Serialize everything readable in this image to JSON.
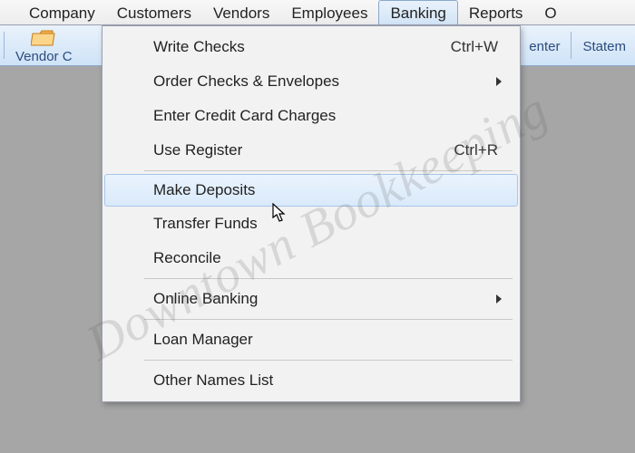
{
  "menubar": {
    "items": [
      {
        "label": "Company"
      },
      {
        "label": "Customers"
      },
      {
        "label": "Vendors"
      },
      {
        "label": "Employees"
      },
      {
        "label": "Banking",
        "active": true
      },
      {
        "label": "Reports"
      },
      {
        "label": "O"
      }
    ]
  },
  "toolbar": {
    "vendor_label": "Vendor C",
    "enter_label": "enter",
    "statem_label": "Statem"
  },
  "dropdown": {
    "items": [
      {
        "label": "Write Checks",
        "accel": "Ctrl+W"
      },
      {
        "label": "Order Checks & Envelopes",
        "submenu": true
      },
      {
        "label": "Enter Credit Card Charges"
      },
      {
        "label": "Use Register",
        "accel": "Ctrl+R"
      },
      {
        "sep": true
      },
      {
        "label": "Make Deposits",
        "hovered": true
      },
      {
        "label": "Transfer Funds"
      },
      {
        "label": "Reconcile"
      },
      {
        "sep": true
      },
      {
        "label": "Online Banking",
        "submenu": true
      },
      {
        "sep": true
      },
      {
        "label": "Loan Manager"
      },
      {
        "sep": true
      },
      {
        "label": "Other Names List"
      }
    ]
  },
  "watermark": "Downtown Bookkeeping"
}
